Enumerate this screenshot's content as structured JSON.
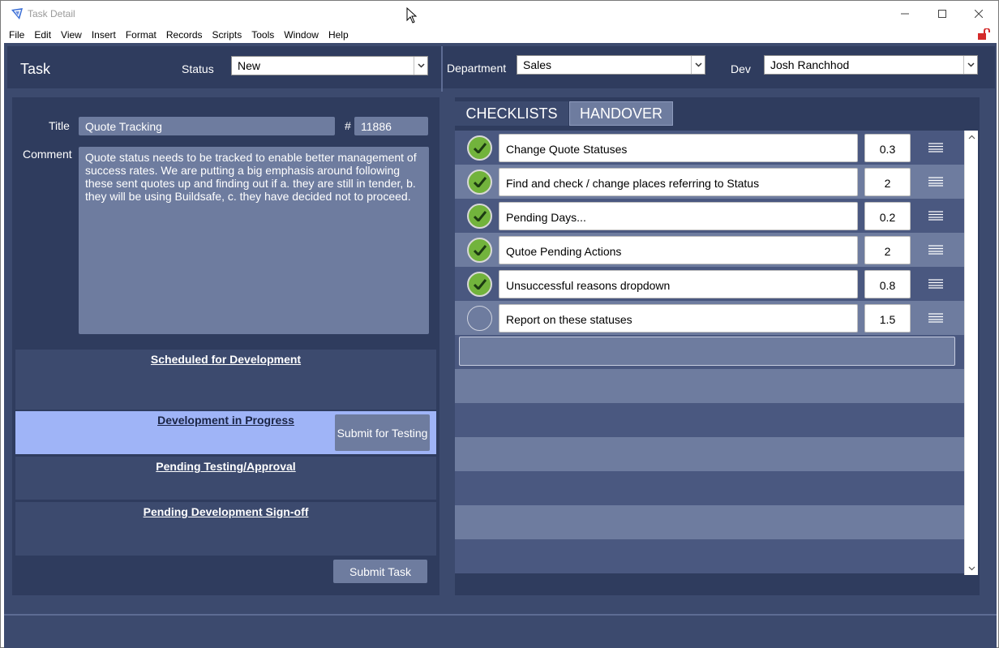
{
  "window": {
    "title": "Task Detail"
  },
  "menu": [
    "File",
    "Edit",
    "View",
    "Insert",
    "Format",
    "Records",
    "Scripts",
    "Tools",
    "Window",
    "Help"
  ],
  "header": {
    "task_label": "Task",
    "status_label": "Status",
    "status_value": "New",
    "department_label": "Department",
    "department_value": "Sales",
    "dev_label": "Dev",
    "dev_value": "Josh Ranchhod"
  },
  "task": {
    "title_label": "Title",
    "title_value": "Quote Tracking",
    "number_label": "#",
    "number_value": "11886",
    "comment_label": "Comment",
    "comment_value": "Quote status needs to be tracked to enable better management of success rates. We are putting a big emphasis around following these sent quotes up and finding out if a. they are still in tender, b. they will be using Buildsafe, c. they have decided not to proceed."
  },
  "stages": [
    {
      "title": "Scheduled for Development",
      "active": false
    },
    {
      "title": "Development in Progress",
      "active": true,
      "button": "Submit for Testing"
    },
    {
      "title": "Pending Testing/Approval",
      "active": false
    },
    {
      "title": "Pending Development Sign-off",
      "active": false
    }
  ],
  "submit_task": "Submit Task",
  "tabs": {
    "checklists": "CHECKLISTS",
    "handover": "HANDOVER",
    "active": "CHECKLISTS"
  },
  "checklist": [
    {
      "text": "Change Quote Statuses",
      "value": "0.3",
      "done": true
    },
    {
      "text": "Find and check / change places referring to Status",
      "value": "2",
      "done": true
    },
    {
      "text": "Pending Days...",
      "value": "0.2",
      "done": true
    },
    {
      "text": "Qutoe Pending Actions",
      "value": "2",
      "done": true
    },
    {
      "text": "Unsuccessful reasons dropdown",
      "value": "0.8",
      "done": true
    },
    {
      "text": "Report on these statuses",
      "value": "1.5",
      "done": false
    }
  ],
  "colors": {
    "background": "#3c4a6e",
    "panel": "#2f3c5e",
    "field": "#6e7c9f",
    "active_stage": "#9fb4f7",
    "check": "#72b33c"
  }
}
